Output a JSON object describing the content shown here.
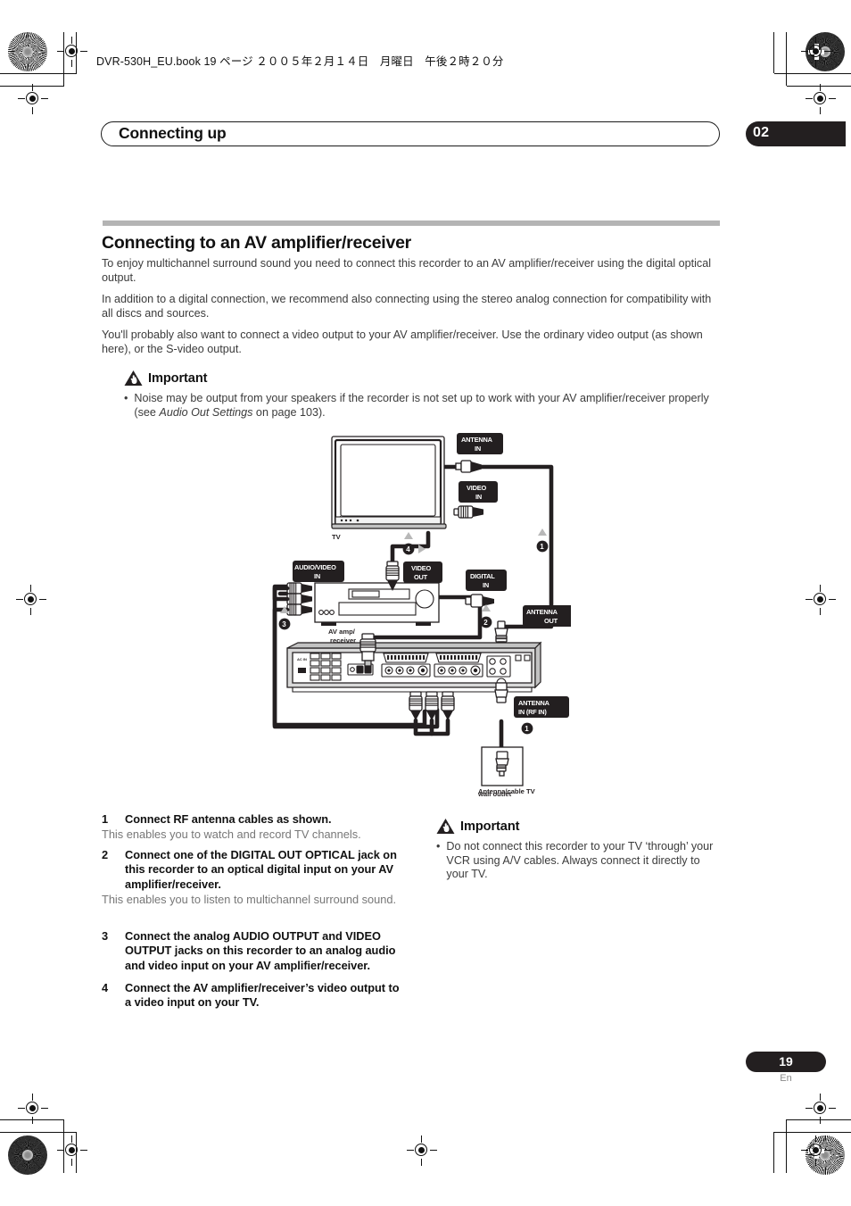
{
  "slug": "DVR-530H_EU.book  19 ページ  ２００５年２月１４日　月曜日　午後２時２０分",
  "header": {
    "running_title": "Connecting up",
    "chapter_number": "02"
  },
  "section": {
    "title": "Connecting to an AV amplifier/receiver",
    "paragraphs": [
      "To enjoy multichannel surround sound you need to connect this recorder to an AV amplifier/receiver using the digital optical output.",
      "In addition to a digital connection, we recommend also connecting using the stereo analog connection for compatibility with all discs and sources.",
      "You'll probably also want to connect a video output to your AV amplifier/receiver. Use the ordinary video output (as shown here), or the S-video output."
    ]
  },
  "important_left": {
    "label": "Important",
    "icon": "warning-hand-triangle-icon",
    "bullet_marker": "•",
    "text_before_italic": "Noise may be output from your speakers if the recorder is not set up to work with your AV amplifier/receiver properly (see ",
    "italic_text": "Audio Out Settings",
    "text_after_italic": " on page 103)."
  },
  "important_right": {
    "label": "Important",
    "icon": "warning-hand-triangle-icon",
    "bullet_marker": "•",
    "text": "Do not connect this recorder to your TV ‘through’ your VCR using A/V cables. Always connect it directly to your TV."
  },
  "steps": [
    {
      "number": "1",
      "heading": "Connect RF antenna cables as shown.",
      "body": "This enables you to watch and record TV channels."
    },
    {
      "number": "2",
      "heading": "Connect one of the DIGITAL OUT OPTICAL jack on this recorder to an optical digital input on your AV amplifier/receiver.",
      "body": "This enables you to listen to multichannel surround sound."
    },
    {
      "number": "3",
      "heading": "Connect the analog AUDIO OUTPUT and VIDEO OUTPUT jacks on this recorder to an analog audio and video input on your AV amplifier/receiver.",
      "body": ""
    },
    {
      "number": "4",
      "heading": "Connect the AV amplifier/receiver’s video output to a video input on your TV.",
      "body": ""
    }
  ],
  "diagram": {
    "name": "av-amplifier-connection-diagram",
    "labels": {
      "antenna_in": "ANTENNA\nIN",
      "antenna_in_line1": "ANTENNA",
      "antenna_in_line2": "IN",
      "video_in_line1": "VIDEO",
      "video_in_line2": "IN",
      "audio_video_in_line1": "AUDIO/VIDEO",
      "audio_video_in_line2": "IN",
      "video_out_line1": "VIDEO",
      "video_out_line2": "OUT",
      "digital_in_line1": "DIGITAL",
      "digital_in_line2": "IN",
      "antenna_out_line1": "ANTENNA",
      "antenna_out_line2": "OUT",
      "antenna_in_rf_line1": "ANTENNA",
      "antenna_in_rf_line2": "IN (RF IN)",
      "tv": "TV",
      "av_amp_line1": "AV amp/",
      "av_amp_line2": "receiver",
      "wall_outlet_line1": "Antenna/cable TV",
      "wall_outlet_line2": "wall outlet"
    },
    "callouts": [
      "1",
      "2",
      "3",
      "4"
    ]
  },
  "footer": {
    "page_number": "19",
    "language": "En"
  },
  "colors": {
    "ink": "#231f20",
    "body_text": "#3b3b3b",
    "muted_text": "#777777",
    "rule_gray": "#b4b4b4",
    "label_black": "#231f20",
    "device_gray": "#d9d9d9"
  }
}
